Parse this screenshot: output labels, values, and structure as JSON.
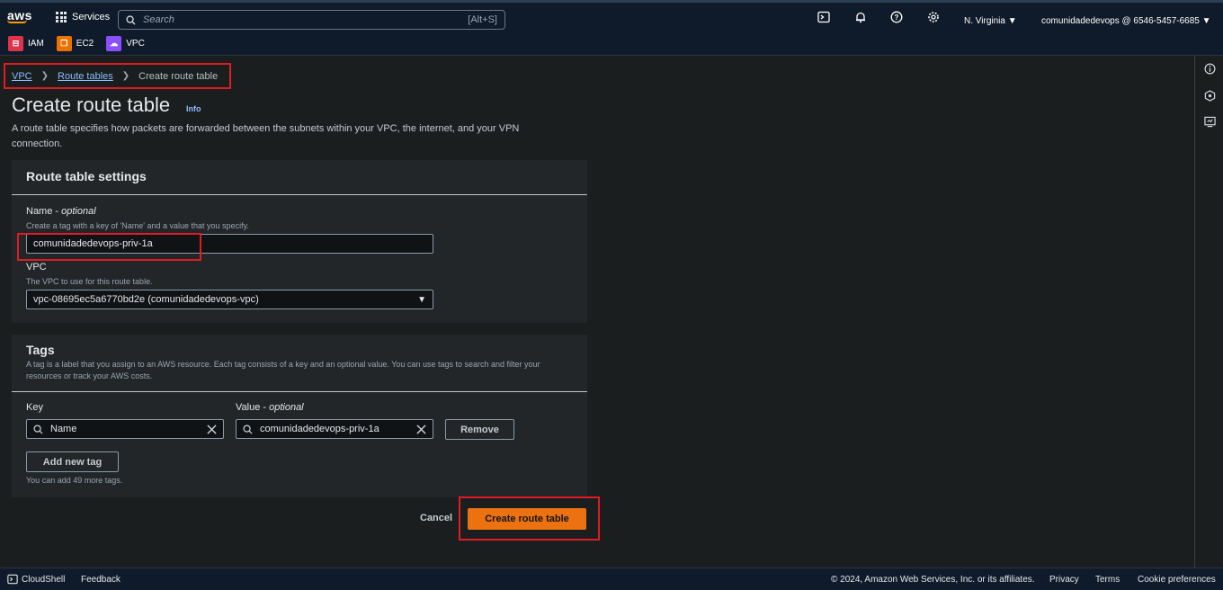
{
  "topnav": {
    "logo": "aws",
    "services_label": "Services",
    "search_placeholder": "Search",
    "search_shortcut": "[Alt+S]",
    "region": "N. Virginia",
    "account": "comunidadedevops @ 6546-5457-6685",
    "icons": [
      "cloudshell-icon",
      "bell-icon",
      "help-icon",
      "settings-icon"
    ]
  },
  "favorites": [
    {
      "label": "IAM",
      "icon": "iam-icon",
      "color": "#dd344c"
    },
    {
      "label": "EC2",
      "icon": "ec2-icon",
      "color": "#ed7100"
    },
    {
      "label": "VPC",
      "icon": "vpc-icon",
      "color": "#8c4fff"
    }
  ],
  "breadcrumb": {
    "vpc": "VPC",
    "route_tables": "Route tables",
    "current": "Create route table"
  },
  "page": {
    "title": "Create route table",
    "info": "Info",
    "description": "A route table specifies how packets are forwarded between the subnets within your VPC, the internet, and your VPN connection."
  },
  "settings": {
    "heading": "Route table settings",
    "name_label": "Name - ",
    "name_optional": "optional",
    "name_hint": "Create a tag with a key of 'Name' and a value that you specify.",
    "name_value": "comunidadedevops-priv-1a",
    "vpc_label": "VPC",
    "vpc_hint": "The VPC to use for this route table.",
    "vpc_value": "vpc-08695ec5a6770bd2e (comunidadedevops-vpc)"
  },
  "tags": {
    "heading": "Tags",
    "description": "A tag is a label that you assign to an AWS resource. Each tag consists of a key and an optional value. You can use tags to search and filter your resources or track your AWS costs.",
    "key_label": "Key",
    "value_label": "Value - ",
    "value_optional": "optional",
    "key_value": "Name",
    "value_value": "comunidadedevops-priv-1a",
    "remove_label": "Remove",
    "add_label": "Add new tag",
    "remaining": "You can add 49 more tags."
  },
  "actions": {
    "cancel": "Cancel",
    "create": "Create route table"
  },
  "footer": {
    "cloudshell": "CloudShell",
    "feedback": "Feedback",
    "copyright": "© 2024, Amazon Web Services, Inc. or its affiliates.",
    "privacy": "Privacy",
    "terms": "Terms",
    "cookies": "Cookie preferences"
  },
  "colors": {
    "accent": "#ec7211",
    "link": "#89bdff",
    "highlight": "#e01b24"
  }
}
